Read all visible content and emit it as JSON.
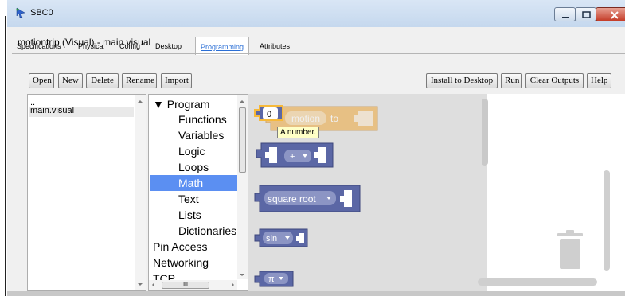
{
  "window": {
    "title": "SBC0"
  },
  "tabs": [
    "Specifications",
    "Physical",
    "Config",
    "Desktop",
    "Programming",
    "Attributes"
  ],
  "project": {
    "title": "motiontrip (Visual) - main.visual"
  },
  "toolbar": {
    "open": "Open",
    "new": "New",
    "delete": "Delete",
    "rename": "Rename",
    "import": "Import",
    "install": "Install to Desktop",
    "run": "Run",
    "clear": "Clear Outputs",
    "help": "Help"
  },
  "files": {
    "parent": "..",
    "items": [
      "main.visual"
    ]
  },
  "categories": {
    "program": "▼ Program",
    "items": [
      "Functions",
      "Variables",
      "Logic",
      "Loops",
      "Math",
      "Text",
      "Lists",
      "Dictionaries",
      "Pin Access",
      "Networking",
      "TCP"
    ]
  },
  "blocks": {
    "number_value": "0",
    "motion_var": "motion",
    "to_label": "to",
    "arith_op": "+",
    "sqrt": "square root",
    "sin": "sin",
    "pi": "π"
  },
  "tooltip": "A number.",
  "scroll": {
    "hthumb_label": "III"
  },
  "colors": {
    "math_block": "#5b67a5",
    "variables_block": "#f0a83c",
    "selected_category": "#5b8ff2",
    "active_tab": "#2b6fd6"
  }
}
